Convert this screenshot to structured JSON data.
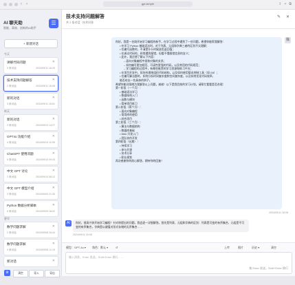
{
  "browser": {
    "url": "gpt.simple",
    "back": "‹",
    "forward": "›",
    "right_icons": [
      "⇪",
      "+",
      "⧉"
    ]
  },
  "sidebar": {
    "title": "AI 聊天助",
    "subtitle": "智能、高效、创新的AI助手",
    "logo": "☰",
    "new_chat": "+ 新建对话",
    "groups": [
      "今天",
      "昨天",
      "更早"
    ],
    "items": [
      {
        "title": "讲解代码问题",
        "count": "5 条对话",
        "date": "2024/09/11 16:20"
      },
      {
        "title": "技术支持问题解答",
        "count": "2 条对话",
        "date": "2024/09/11 16:08"
      },
      {
        "title": "新的对话",
        "count": "3 条对话",
        "date": "2024/09/11 15:51"
      },
      {
        "title": "新的对话",
        "count": "3 条对话",
        "date": "2024/09/10 14:27"
      },
      {
        "title": "GPT4o 功能介绍",
        "count": "4 条对话",
        "date": "2024/09/10 12:05"
      },
      {
        "title": "ChatGPT 使用问题",
        "count": "5 条对话",
        "date": "2024/09/10 09:43"
      },
      {
        "title": "中文 GPT 讨论",
        "count": "2 条对话",
        "date": "2024/09/10 08:12"
      },
      {
        "title": "中文 GPT 模型介绍",
        "count": "3 条对话",
        "date": "2024/09/09 21:30"
      },
      {
        "title": "Python 数据分析脚本",
        "count": "6 条对话",
        "date": "2024/09/09 18:02"
      },
      {
        "title": "数学问题求解",
        "count": "2 条对话",
        "date": "2024/09/08 16:44"
      },
      {
        "title": "数学问题求解",
        "count": "4 条对话",
        "date": "2024/09/08 11:19"
      },
      {
        "title": "新对话",
        "count": "1 条对话",
        "date": "2024/09/07 10:05"
      }
    ],
    "bottom_icon": "⚙",
    "bottom_buttons": [
      "清空",
      "导入",
      "导出"
    ]
  },
  "chat": {
    "title": "技术支持问题解答",
    "subtitle": "共 2 条对话 · 技术问答",
    "head_icons": [
      "✎",
      "✕"
    ],
    "user_lines": [
      {
        "t": "你好，我是一名刚开始学习编程的新手，在学习过程中遇到了一些问题，希望你能帮我解答：",
        "lvl": 0
      },
      {
        "t": "• 在学习 Python 基础语法时，对于列表、元组和字典三者的区别不太理解；",
        "lvl": 1
      },
      {
        "t": "• 在编写函数时，不清楚什么时候该用返回值；",
        "lvl": 1
      },
      {
        "t": "• 在调试代码时，经常遇到报错，但看不懂报错信息的含义；",
        "lvl": 1
      },
      {
        "t": "• 此外，我还想了解以下内容：",
        "lvl": 1
      },
      {
        "t": "– 面向对象编程中类和对象的关系；",
        "lvl": 2
      },
      {
        "t": "– 如何编写更加规范、可读性更强的代码，以及常用的代码规范；",
        "lvl": 2
      },
      {
        "t": "– 学习编程的过程中，有哪些推荐的学习资源和练习平台；",
        "lvl": 2
      },
      {
        "t": "• 在项目开发中，如何合理地组织代码结构，以及如何使用版本控制工具（如 Git）；",
        "lvl": 1
      },
      {
        "t": "• 在编写算法题时，如何分析时间复杂度和空间复杂度，以及如何优化代码效率，",
        "lvl": 1
      },
      {
        "t": "  能否给出一些具体的例子。",
        "lvl": 1
      },
      {
        "t": "希望你能详细地为我解答以上问题，谢谢！以下是我目前的学习计划，请帮忙看看是否合理：",
        "lvl": 0
      },
      {
        "t": "第一阶段（一个月）：",
        "lvl": 0
      },
      {
        "t": "• 基础语法学习",
        "lvl": 1
      },
      {
        "t": "• 数据结构入门",
        "lvl": 1
      },
      {
        "t": "• 函数与模块",
        "lvl": 1
      },
      {
        "t": "• 简单项目练习",
        "lvl": 1
      },
      {
        "t": "第二阶段（两个月）：",
        "lvl": 0
      },
      {
        "t": "• 面向对象编程",
        "lvl": 1
      },
      {
        "t": "• 常用库的使用",
        "lvl": 1
      },
      {
        "t": "• 综合项目",
        "lvl": 1
      },
      {
        "t": "第三阶段（三个月）：",
        "lvl": 0
      },
      {
        "t": "• 算法与数据结构",
        "lvl": 1
      },
      {
        "t": "• 数据库基础",
        "lvl": 1
      },
      {
        "t": "• Web 开发入门",
        "lvl": 1
      },
      {
        "t": "• 团队协作开发",
        "lvl": 1
      },
      {
        "t": "第四阶段（长期）：",
        "lvl": 0
      },
      {
        "t": "• 持续学习",
        "lvl": 1
      },
      {
        "t": "• 参与开源",
        "lvl": 1
      },
      {
        "t": "• 技术分享",
        "lvl": 1
      },
      {
        "t": "• 职业规划",
        "lvl": 1
      },
      {
        "t": "再次感谢你的耐心解答，期待你的回复！",
        "lvl": 0
      }
    ],
    "user_avatar": "我",
    "user_time": "2024/09/11 16:08",
    "bot_avatar": "AI",
    "bot_reply": "你好，很高兴你开始学习编程！针对你提出的问题，我会逐一详细解答。首先是列表、元组和字典的区别：列表是可变的有序集合，元组是不可变的有序集合，字典是以键值对形式存储的无序集合……",
    "bot_time": "2024/09/11 16:08"
  },
  "compose": {
    "tools_left": [
      "模型：GPT-4o ▾",
      "角色：默认 ▾",
      "↺"
    ],
    "tools_right": [
      "上传",
      "图片",
      "历史 ▾",
      "清空"
    ],
    "placeholder": "输入消息，Enter 发送，Shift+Enter 换行……",
    "send_hint": "按 Enter 发送，Shift+Enter 换行"
  }
}
